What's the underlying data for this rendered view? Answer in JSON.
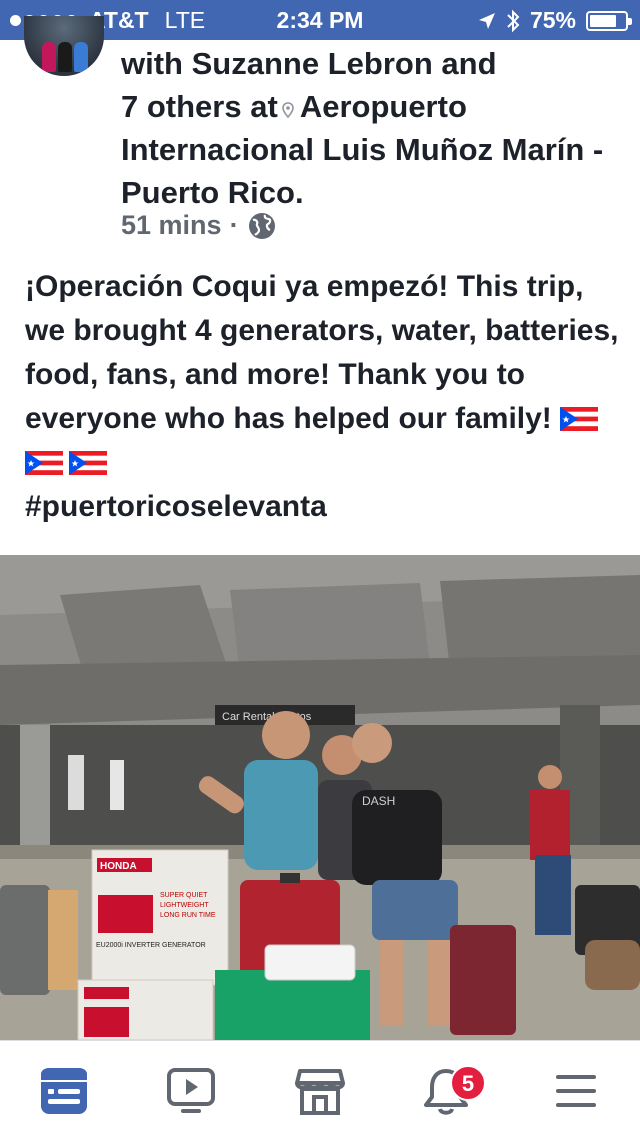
{
  "status_bar": {
    "carrier": "AT&T",
    "network": "LTE",
    "time": "2:34 PM",
    "battery": "75%",
    "battery_level": 0.75,
    "signal_bars_filled": 3,
    "signal_bars_total": 5
  },
  "post": {
    "header_prefix": "with",
    "tagged_name": "Suzanne Lebron",
    "and_text": "and",
    "others": "7 others",
    "at_text": "at",
    "location": "Aeropuerto Internacional Luis Muñoz Marín - Puerto Rico.",
    "timestamp": "51 mins",
    "separator": "·",
    "privacy_icon": "globe-icon",
    "body": "¡Operación Coqui ya empezó! This trip, we brought 4 generators, water, batteries, food, fans, and more! Thank you to everyone who has helped our family!",
    "hashtag": "#puertoricoselevanta",
    "flag_count": 3
  },
  "photo": {
    "sign_text": "Car Rental / Autos",
    "box_brand": "HONDA",
    "box_model": "EU2000i INVERTER GENERATOR",
    "box_lines": [
      "SUPER QUIET",
      "LIGHTWEIGHT",
      "LONG RUN TIME"
    ],
    "shirt_text": "DASH"
  },
  "tab_bar": {
    "items": [
      "news-feed-icon",
      "watch-icon",
      "marketplace-icon",
      "notifications-icon",
      "menu-icon"
    ],
    "notification_count": "5",
    "active_color": "#4267b2",
    "inactive_color": "#606770"
  },
  "colors": {
    "facebook_blue": "#4267b2",
    "badge_red": "#e41e3f"
  }
}
